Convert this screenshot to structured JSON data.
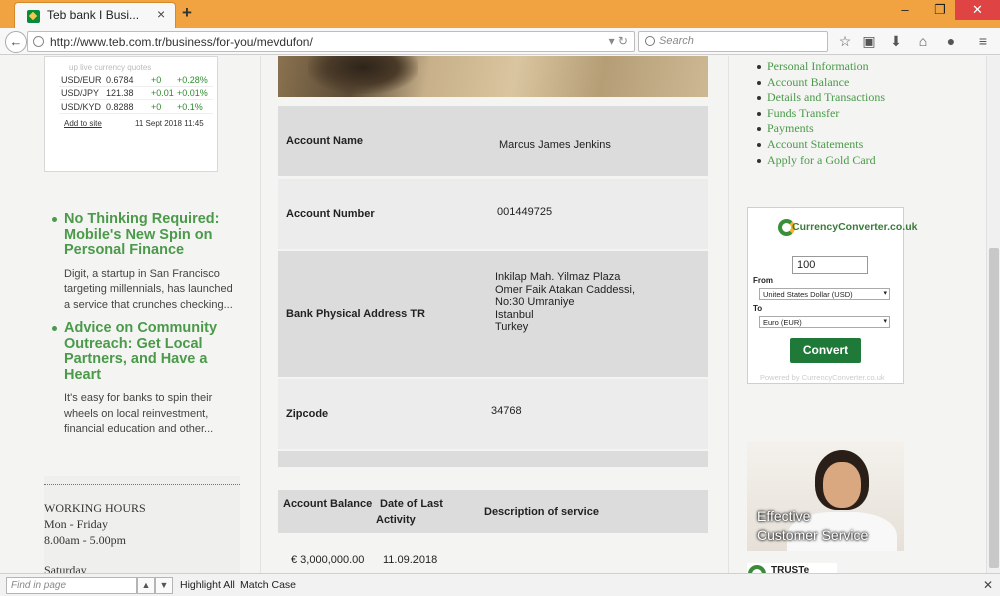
{
  "browser": {
    "tab_title": "Teb bank I Busi...",
    "tab_close": "×",
    "new_tab": "+",
    "url": "http://www.teb.com.tr/business/for-you/mevdufon/",
    "search_placeholder": "Search",
    "back": "←",
    "win_min": "–",
    "win_max": "❐",
    "win_close": "✕",
    "toolbar_icons": [
      "star-icon",
      "reading-list-icon",
      "download-icon",
      "home-icon",
      "chat-icon",
      "menu-icon"
    ]
  },
  "fx_widget": {
    "header": "up live currency quotes",
    "rows": [
      {
        "pair": "USD/EUR",
        "rate": "0.6784",
        "change": "+0",
        "percent": "+0.28%"
      },
      {
        "pair": "USD/JPY",
        "rate": "121.38",
        "change": "+0.01",
        "percent": "+0.01%"
      },
      {
        "pair": "USD/KYD",
        "rate": "0.8288",
        "change": "+0",
        "percent": "+0.1%"
      }
    ],
    "add_link": "Add to site",
    "timestamp": "11 Sept 2018 11:45"
  },
  "news": [
    {
      "title": "No Thinking Required: Mobile's New Spin on Personal Finance",
      "body": "Digit, a startup in San Francisco targeting millennials, has launched a service that crunches checking..."
    },
    {
      "title": "Advice on Community Outreach: Get Local Partners, and Have a Heart",
      "body": "It's easy for banks to spin their wheels on local reinvestment, financial education and other..."
    }
  ],
  "hours": {
    "divider": "........................................",
    "title": "WORKING HOURS",
    "weekdays": "Mon - Friday",
    "weekday_time": "8.00am - 5.00pm",
    "saturday": "Saturday"
  },
  "account": {
    "name_label": "Account Name",
    "name_value": "Marcus James Jenkins",
    "number_label": "Account Number",
    "number_value": "001449725",
    "address_label": "Bank Physical Address TR",
    "address_lines": [
      "Inkilap Mah. Yilmaz Plaza",
      "Omer Faik Atakan Caddessi,",
      "No:30 Umraniye",
      "Istanbul",
      "Turkey"
    ],
    "zip_label": "Zipcode",
    "zip_value": "34768"
  },
  "balance_table": {
    "col_balance": "Account Balance",
    "col_date_1": "Date of Last",
    "col_date_2": "Activity",
    "col_desc": "Description of service",
    "balance": "€  3,000,000.00",
    "date": "11.09.2018"
  },
  "side_links": [
    "Personal Information",
    "Account Balance",
    "Details and Transactions",
    "Funds Transfer",
    "Payments",
    "Account Statements",
    "Apply for a Gold Card"
  ],
  "converter": {
    "logo": "CurrencyConverter.co.uk",
    "amount": "100",
    "from_label": "From",
    "from_value": "United States Dollar (USD)",
    "to_label": "To",
    "to_value": "Euro (EUR)",
    "button": "Convert",
    "footer": "Powered by CurrencyConverter.co.uk"
  },
  "promo": {
    "line1": "Effective",
    "line2": "Customer Service",
    "truste": "TRUSTe"
  },
  "findbar": {
    "placeholder": "Find in page",
    "up": "▲",
    "down": "▼",
    "highlight": "Highlight All",
    "match_case": "Match Case",
    "close": "✕"
  }
}
